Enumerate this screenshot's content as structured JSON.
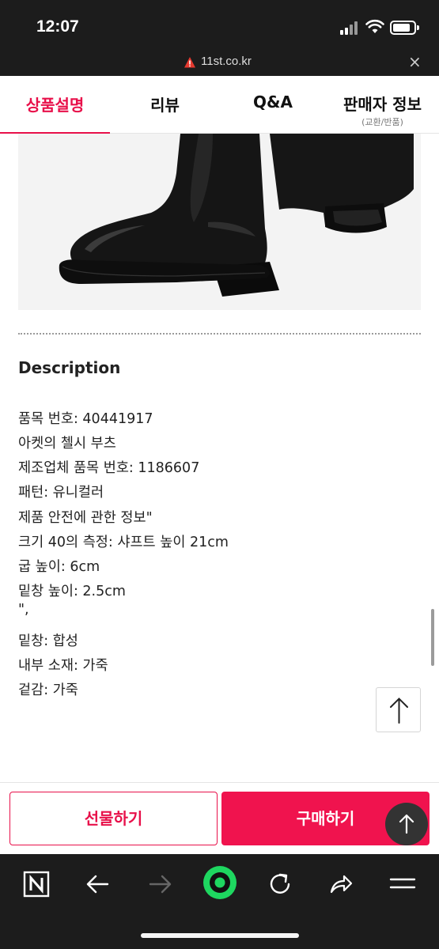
{
  "status_bar": {
    "time": "12:07"
  },
  "url_bar": {
    "url": "11st.co.kr"
  },
  "tabs": [
    {
      "label": "상품설명",
      "sub": ""
    },
    {
      "label": "리뷰",
      "sub": ""
    },
    {
      "label": "Q&A",
      "sub": ""
    },
    {
      "label": "판매자 정보",
      "sub": "(교환/반품)"
    }
  ],
  "description": {
    "title": "Description",
    "lines": [
      "품목 번호: 40441917",
      "아켓의 첼시 부츠",
      "제조업체 품목 번호: 1186607",
      "패턴: 유니컬러",
      "제품 안전에 관한 정보\"",
      "크기 40의 측정: 샤프트 높이 21cm",
      "굽 높이: 6cm",
      "밑창 높이: 2.5cm",
      "\",",
      "밑창: 합성",
      "내부 소재: 가죽",
      "겉감: 가죽"
    ]
  },
  "actions": {
    "gift": "선물하기",
    "buy": "구매하기"
  },
  "colors": {
    "accent": "#e8104a",
    "chrome": "#1c1c1c",
    "green_button": "#1ed760"
  }
}
